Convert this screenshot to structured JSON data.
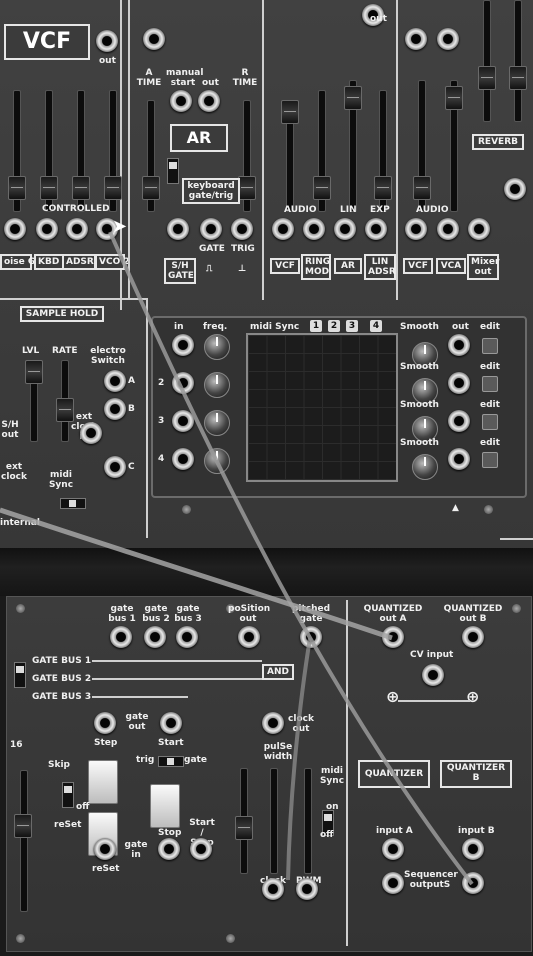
{
  "vcf": {
    "title": "VCF",
    "out_label": "out",
    "controlled_label": "CONTROLLED",
    "inputs": [
      "oise GEN",
      "KBD CV",
      "ADSR",
      "VCO 2"
    ]
  },
  "ar": {
    "title": "AR",
    "a_time": "A TIME",
    "r_time": "R TIME",
    "manual_start": "manual start",
    "out_label": "out",
    "keyboard_label": "keyboard gate/trig",
    "sh_gate": "S/H GATE",
    "gate_label": "GATE",
    "trig_label": "TRIG"
  },
  "vca": {
    "audio_label": "AUDIO",
    "lin_label": "LIN",
    "exp_label": "EXP",
    "inputs": [
      "VCF",
      "RING MOD",
      "AR",
      "LIN ADSR"
    ]
  },
  "mixer": {
    "audio_label": "AUDIO",
    "inputs": [
      "VCF",
      "VCA",
      "Mixer out"
    ],
    "reverb_label": "REVERB",
    "out_label": "out"
  },
  "sample_hold": {
    "title": "SAMPLE HOLD",
    "lvl_label": "LVL",
    "rate_label": "RATE",
    "electro_switch": "electro Switch",
    "ext_clock_in": "ext clock in",
    "midi_sync": "midi Sync",
    "sh_out": "S/H out",
    "ext_clock": "ext clock",
    "internal": "internal",
    "jack_a": "A",
    "jack_b": "B",
    "jack_c": "C"
  },
  "lfo": {
    "in_label": "in",
    "freq_label": "freq.",
    "midi_sync_label": "midi Sync",
    "sync_buttons": [
      "1",
      "2",
      "3",
      "4"
    ],
    "smooth_label": "Smooth",
    "out_label": "out",
    "edit_label": "edit",
    "rows": [
      "",
      "2",
      "3",
      "4"
    ]
  },
  "sequencer": {
    "gate_bus_1": "gate bus 1",
    "gate_bus_2": "gate bus 2",
    "gate_bus_3": "gate bus 3",
    "position_out": "poSition out",
    "pitched_gate": "pitched gate",
    "bus1_line": "GATE BUS 1",
    "bus2_line": "GATE BUS 2",
    "bus3_line": "GATE BUS 3",
    "and_label": "AND",
    "clock_out": "clock out",
    "gate_out": "gate out",
    "step_label": "Step",
    "start_label": "Start",
    "trig_label": "trig",
    "gate_label": "gate",
    "skip_label": "Skip",
    "off_label": "off",
    "reset_label": "reSet",
    "stop_label": "Stop",
    "start_stop": "Start / Stop",
    "gate_in": "gate in",
    "pulse_width": "pulSe width",
    "midi_sync": "midi Sync",
    "on_label": "on",
    "number_16": "16",
    "clock_label": "clock",
    "pwm_label": "PWM"
  },
  "quantizer": {
    "quantized_out_a": "QUANTIZED out A",
    "quantized_out_b": "QUANTIZED out B",
    "cv_input": "CV input",
    "quantizer_a": "QUANTIZER",
    "quantizer_b": "QUANTIZER B",
    "input_a": "input A",
    "input_b": "input B",
    "sequencer_outputs": "Sequencer outputS"
  }
}
